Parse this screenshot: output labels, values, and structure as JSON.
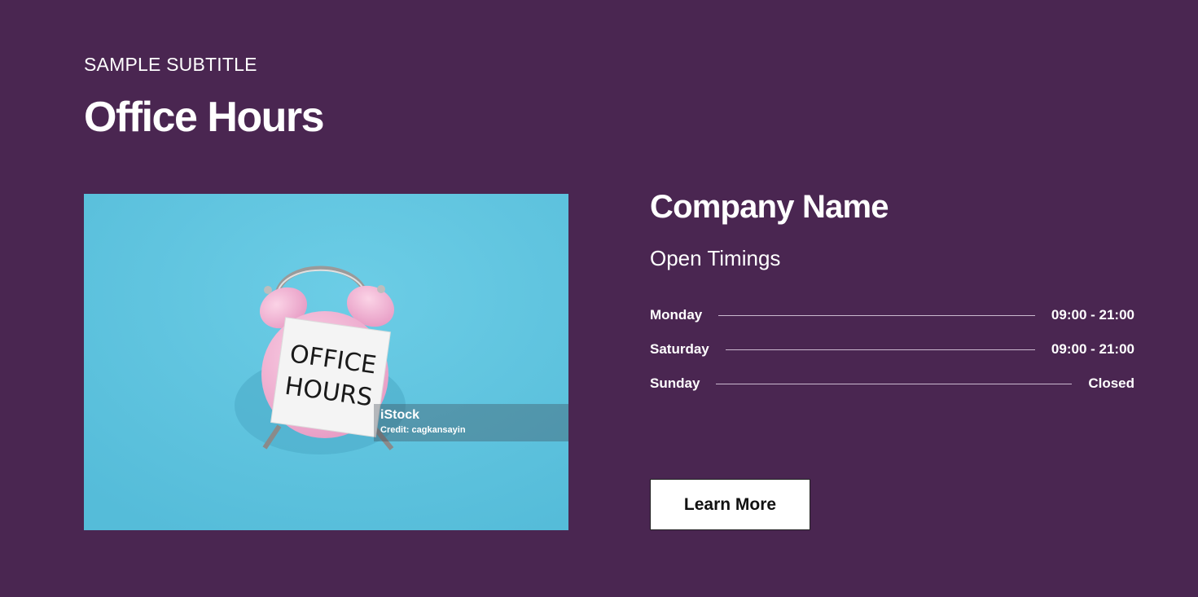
{
  "header": {
    "subtitle": "SAMPLE SUBTITLE",
    "title": "Office Hours"
  },
  "image": {
    "note_line1": "OFFICE",
    "note_line2": "HOURS",
    "watermark_brand": "iStock",
    "watermark_credit": "Credit: cagkansayin"
  },
  "company": {
    "name": "Company Name",
    "timings_heading": "Open Timings",
    "hours": [
      {
        "day": "Monday",
        "time": "09:00 - 21:00"
      },
      {
        "day": "Saturday",
        "time": "09:00 - 21:00"
      },
      {
        "day": "Sunday",
        "time": "Closed"
      }
    ],
    "button_label": "Learn More"
  },
  "colors": {
    "background": "#4a2651",
    "photo_background": "#62c6e1",
    "button_background": "#ffffff"
  }
}
